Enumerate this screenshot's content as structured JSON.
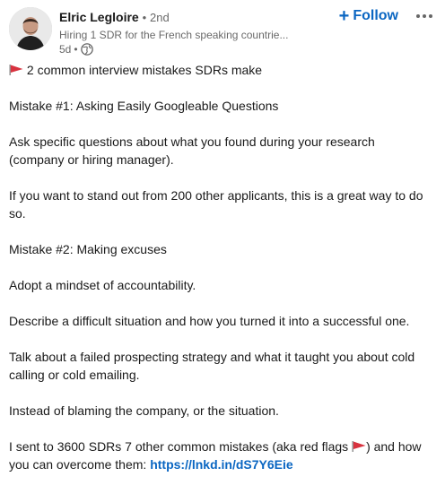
{
  "post": {
    "author": {
      "name": "Elric Legloire",
      "separator": "•",
      "degree": "2nd",
      "headline": "Hiring 1 SDR for the French speaking countrie...",
      "timestamp": "5d",
      "meta_separator": "•",
      "visibility_icon": "globe-icon"
    },
    "actions": {
      "follow_label": "Follow",
      "follow_icon": "plus-icon",
      "more_icon": "ellipsis-icon"
    },
    "body": {
      "title": "2 common interview mistakes SDRs make",
      "p1": "Mistake #1: Asking Easily Googleable Questions",
      "p2": "Ask specific questions about what you found during your research (company or hiring manager).",
      "p3": "If you want to stand out from 200 other applicants, this is a great way to do so.",
      "p4": "Mistake #2: Making excuses",
      "p5": "Adopt a mindset of accountability.",
      "p6": "Describe a difficult situation and how you turned it into a successful one.",
      "p7": "Talk about a failed prospecting strategy and what it taught you about cold calling or cold emailing.",
      "p8": "Instead of blaming the company, or the situation.",
      "p9_before": "I sent to 3600 SDRs 7 other common mistakes (aka red flags ",
      "p9_after": ") and how you can overcome them: ",
      "link": "https://lnkd.in/dS7Y6Eie",
      "flag_icon": "red-flag-icon"
    },
    "colors": {
      "link": "#0a66c2",
      "flag": "#d8333f",
      "text": "#191919",
      "muted": "#666666"
    }
  }
}
